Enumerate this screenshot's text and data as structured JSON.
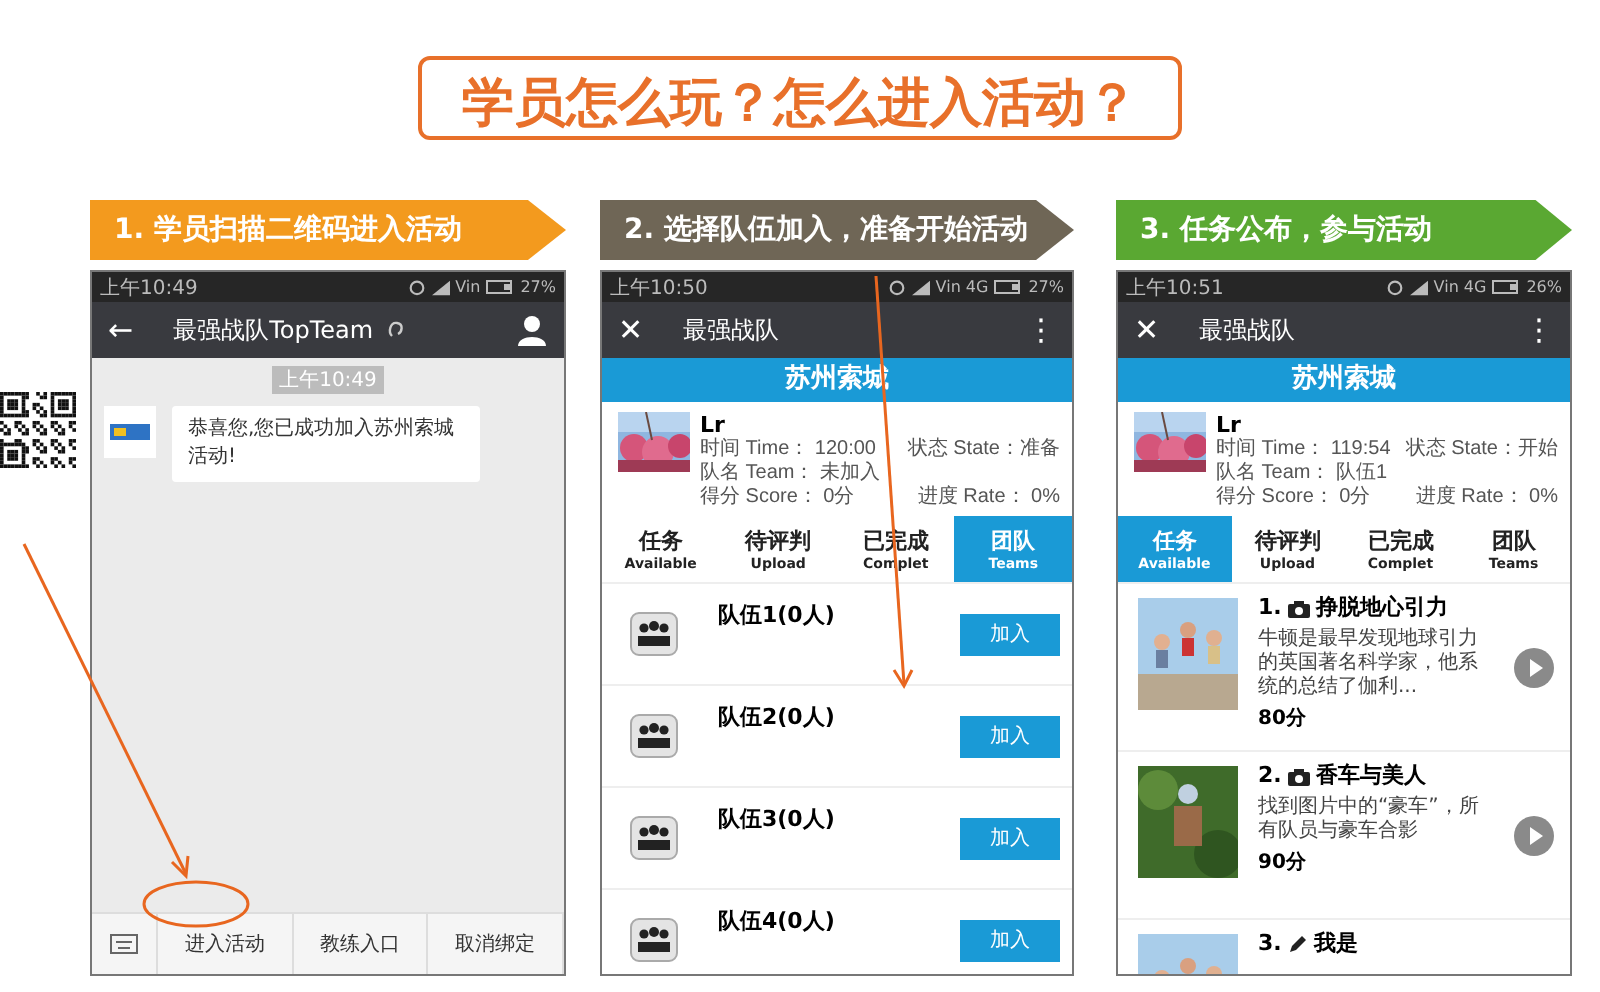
{
  "slide_title": "学员怎么玩？怎么进入活动？",
  "steps": [
    {
      "label": "1. 学员扫描二维码进入活动",
      "color": "#f39a1e"
    },
    {
      "label": "2. 选择队伍加入，准备开始活动",
      "color": "#6f6656"
    },
    {
      "label": "3. 任务公布，参与活动",
      "color": "#5aa832"
    }
  ],
  "phones": [
    {
      "kind": "chat",
      "status_time": "上午10:49",
      "network": "Vin",
      "battery": "27%",
      "nav_icon": "←",
      "nav_title": "最强战队TopTeam",
      "timestamp": "上午10:49",
      "message": "恭喜您,您已成功加入苏州索城活动!",
      "menu": [
        "进入活动",
        "教练入口",
        "取消绑定"
      ]
    },
    {
      "kind": "activity",
      "status_time": "上午10:50",
      "network": "Vin 4G",
      "battery": "27%",
      "nav_icon": "✕",
      "nav_title": "最强战队",
      "menu_icon": "⋮",
      "banner": "苏州索城",
      "profile": {
        "name": "Lr",
        "time": "时间 Time： 120:00",
        "state": "状态 State：准备",
        "team": "队名 Team： 未加入",
        "score": "得分 Score： 0分",
        "rate": "进度 Rate： 0%"
      },
      "tabs": [
        {
          "zh": "任务",
          "en": "Available",
          "selected": false
        },
        {
          "zh": "待评判",
          "en": "Upload",
          "selected": false
        },
        {
          "zh": "已完成",
          "en": "Complet",
          "selected": false
        },
        {
          "zh": "团队",
          "en": "Teams",
          "selected": true
        }
      ],
      "teams": [
        {
          "name": "队伍1(0人)",
          "button": "加入"
        },
        {
          "name": "队伍2(0人)",
          "button": "加入"
        },
        {
          "name": "队伍3(0人)",
          "button": "加入"
        },
        {
          "name": "队伍4(0人)",
          "button": "加入"
        }
      ]
    },
    {
      "kind": "activity",
      "status_time": "上午10:51",
      "network": "Vin 4G",
      "battery": "26%",
      "nav_icon": "✕",
      "nav_title": "最强战队",
      "menu_icon": "⋮",
      "banner": "苏州索城",
      "profile": {
        "name": "Lr",
        "time": "时间 Time： 119:54",
        "state": "状态 State：开始",
        "team": "队名 Team： 队伍1",
        "score": "得分 Score： 0分",
        "rate": "进度 Rate： 0%"
      },
      "tabs": [
        {
          "zh": "任务",
          "en": "Available",
          "selected": true
        },
        {
          "zh": "待评判",
          "en": "Upload",
          "selected": false
        },
        {
          "zh": "已完成",
          "en": "Complet",
          "selected": false
        },
        {
          "zh": "团队",
          "en": "Teams",
          "selected": false
        }
      ],
      "tasks": [
        {
          "number": "1.",
          "title": "挣脱地心引力",
          "description": "牛顿是最早发现地球引力的英国著名科学家，他系统的总结了伽利...",
          "score": "80分"
        },
        {
          "number": "2.",
          "title": "香车与美人",
          "description": "找到图片中的“豪车”，所有队员与豪车合影",
          "score": "90分"
        },
        {
          "number": "3.",
          "kind": "text",
          "title": "我是"
        }
      ]
    }
  ]
}
